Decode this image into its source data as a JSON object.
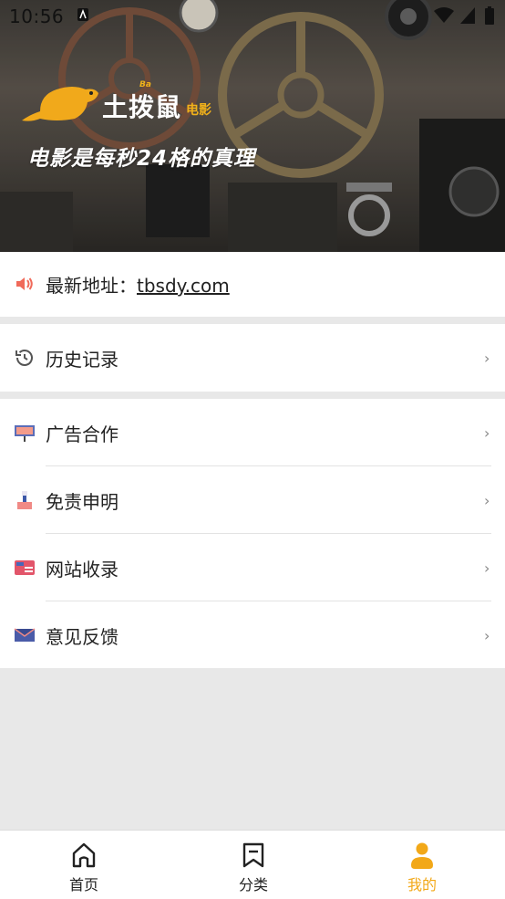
{
  "status_bar": {
    "time": "10:56"
  },
  "banner": {
    "logo_text": "土拨鼠",
    "logo_sub": "电影",
    "logo_ba": "Ba",
    "slogan": "电影是每秒24格的真理"
  },
  "address": {
    "label": "最新地址：",
    "link": "tbsdy.com",
    "icon": "speaker-icon"
  },
  "history": {
    "label": "历史记录",
    "icon": "history-icon"
  },
  "menu": [
    {
      "label": "广告合作",
      "icon": "billboard-icon"
    },
    {
      "label": "免责申明",
      "icon": "notary-icon"
    },
    {
      "label": "网站收录",
      "icon": "card-icon"
    },
    {
      "label": "意见反馈",
      "icon": "mail-icon"
    }
  ],
  "chevron": "›",
  "tabbar": {
    "tabs": [
      {
        "label": "首页",
        "icon": "home-icon"
      },
      {
        "label": "分类",
        "icon": "bookmark-icon"
      },
      {
        "label": "我的",
        "icon": "user-icon",
        "active": true
      }
    ],
    "active_color": "#f2a818"
  },
  "colors": {
    "accent": "#f2a818",
    "page_bg": "#e8e8e8"
  }
}
